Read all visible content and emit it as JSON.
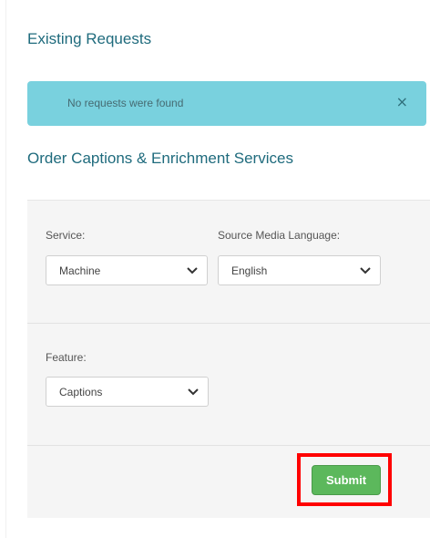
{
  "existing_requests": {
    "title": "Existing Requests",
    "alert": {
      "message": "No requests were found",
      "close_symbol": "×",
      "color": "#79d1de"
    }
  },
  "order": {
    "title": "Order Captions & Enrichment Services",
    "service": {
      "label": "Service:",
      "value": "Machine"
    },
    "language": {
      "label": "Source Media Language:",
      "value": "English"
    },
    "feature": {
      "label": "Feature:",
      "value": "Captions"
    },
    "submit": {
      "label": "Submit",
      "color": "#5cb85c",
      "highlight_color": "#ff0000"
    }
  },
  "icons": {
    "dropdown": "chevron-down-icon",
    "close": "close-icon"
  }
}
